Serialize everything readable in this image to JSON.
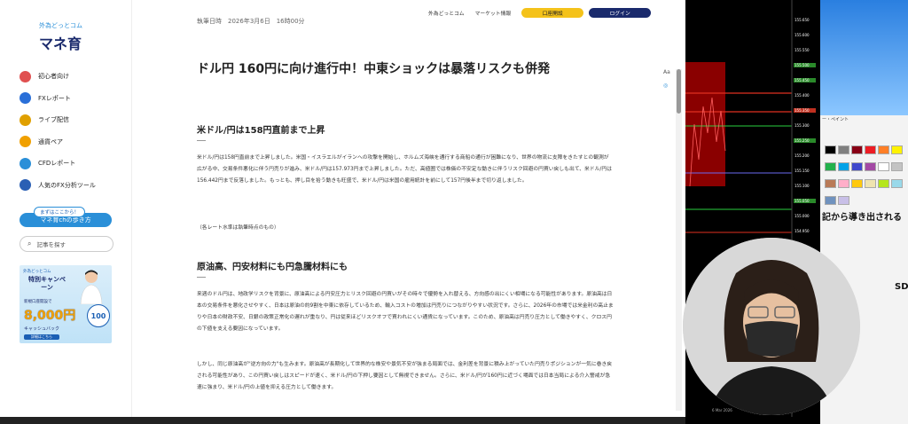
{
  "sidebar": {
    "logo_small": "外為どっとコム",
    "logo_big": "マネ育",
    "nav": [
      {
        "label": "初心者向け",
        "color": "#e05050"
      },
      {
        "label": "FXレポート",
        "color": "#2a6fd8"
      },
      {
        "label": "ライブ配信",
        "color": "#e0a000"
      },
      {
        "label": "通貨ペア",
        "color": "#f0a000"
      },
      {
        "label": "CFDレポート",
        "color": "#2a8fd8"
      },
      {
        "label": "人気のFX分析ツール",
        "color": "#2a5fb4"
      }
    ],
    "guide_tag": "まずはここから！",
    "guide_button": "マネ育chの歩き方",
    "search_label": "記事を探す",
    "banner": {
      "top": "外為どっとコム",
      "headline": "特別キャンペーン",
      "line1": "新規口座開設で",
      "amount": "8,000円",
      "line2": "キャッシュバック",
      "details": "詳細はこちら",
      "badge": "100"
    }
  },
  "header": {
    "date": "執筆日時　2026年3月6日　16時00分",
    "link1": "外為どっとコム",
    "link2": "マーケット情報",
    "open_account": "口座開設",
    "login": "ログイン"
  },
  "article": {
    "title": "ドル円 160円に向け進行中！中東ショックは暴落リスクも併発",
    "section1_heading": "米ドル/円は158円直前まで上昇",
    "section1_para": "米ドル/円は158円直前まで上昇しました。米国・イスラエルがイランへの攻撃を開始し、ホルムズ海峡を通行する商船の通行が困難になり、世界の物流に支障をきたすとの観測が広がる中、交易条件悪化に伴う円売りが進み、米ドル/円は157.973円まで上昇しました。ただ、高値圏では株価の不安定な動きに伴うリスク回避の円買い戻しも出て、米ドル/円は156.442円まで反落しました。もっとも、押し目を拾う動きも旺盛で、米ドル/円は米国の雇用統計を前にして157円後半まで切り返しました。",
    "note": "（各レート水準は執筆時点のもの）",
    "section2_heading": "原油高、円安材料にも円急騰材料にも",
    "section2_para1": "来週のドル円は、地政学リスクを背景に、原油高による円安圧力とリスク回避の円買いがその時々で優勢を入れ替える、方向感の出にくい相場になる可能性があります。原油高は日本の交易条件を悪化させやすく、日本は原油の約9割を中東に依存しているため、輸入コストの増加は円売りにつながりやすい状況です。さらに、2026年の市場では米金利の高止まりや日本の財政不安、日銀の政策正常化の遅れが重なり、円は従来ほどリスクオフで買われにくい通貨になっています。このため、原油高は円売り圧力として働きやすく、クロス円の下値を支える要因になっています。",
    "section2_para2": "しかし、同じ原油高が\"逆方向の力\"も生みます。原油高が長期化して世界的な株安や景気不安が強まる局面では、金利差を背景に積み上がっていた円売りポジションが一気に巻き戻される可能性があり、この円買い戻しはスピードが速く、米ドル/円の下押し要因として無視できません。さらに、米ドル/円が160円に近づく場面では日本当局による介入警戒が急速に強まり、米ドル/円の上値を抑える圧力として働きます。"
  },
  "chart_prices": [
    "155.650",
    "155.600",
    "155.550",
    "155.500",
    "155.450",
    "155.400",
    "155.350",
    "155.300",
    "155.250",
    "155.200",
    "155.150",
    "155.100",
    "155.050",
    "155.000",
    "154.950"
  ],
  "chart_date": "6 Mar 2026",
  "paint": {
    "label": "ー・ペイント",
    "text1": "記から導き出される",
    "text2": "SD"
  },
  "colors": {
    "accent_blue": "#2a8fd8",
    "navy": "#1a2a6c",
    "yellow": "#f4c21a"
  }
}
